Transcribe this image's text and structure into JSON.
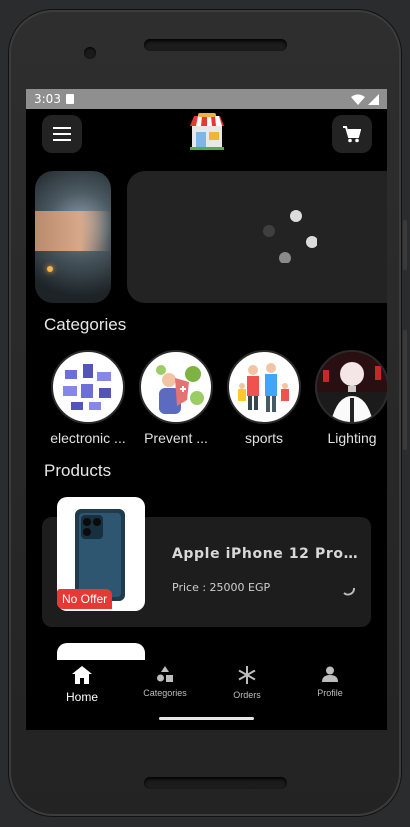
{
  "status_bar": {
    "time": "3:03"
  },
  "app_bar": {
    "menu_icon": "hamburger-menu-icon",
    "logo_icon": "store-logo-icon",
    "cart_icon": "shopping-cart-icon"
  },
  "sections": {
    "categories_title": "Categories",
    "products_title": "Products"
  },
  "categories": [
    {
      "label": "electronic ..."
    },
    {
      "label": "Prevent ..."
    },
    {
      "label": "sports"
    },
    {
      "label": "Lighting"
    }
  ],
  "product": {
    "name": "Apple iPhone 12 Pro Ma...",
    "price": "Price : 25000 EGP",
    "badge": "No Offer"
  },
  "bottom_nav": {
    "home": "Home",
    "categories": "Categories",
    "orders": "Orders",
    "profile": "Profile"
  },
  "colors": {
    "badge": "#e53935",
    "card": "#1d1d1d",
    "status_bar": "#8f8f8f"
  }
}
